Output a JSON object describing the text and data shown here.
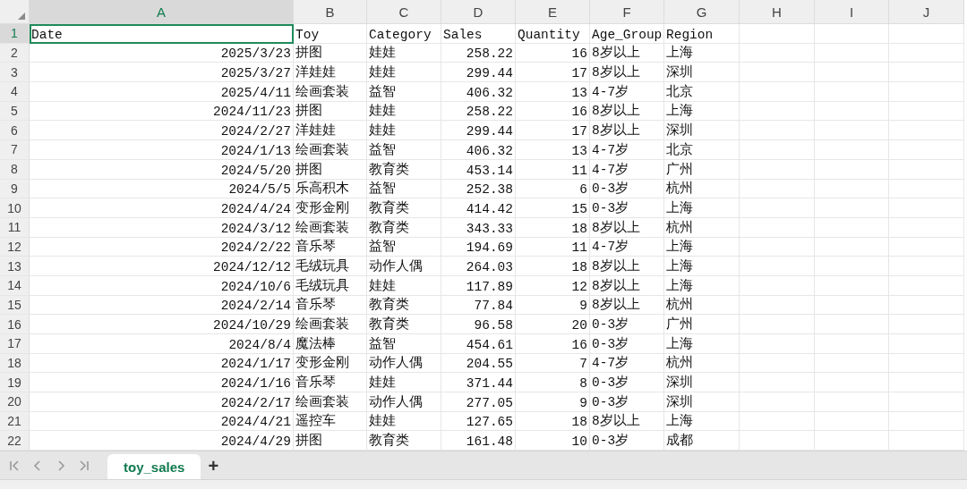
{
  "columns": [
    {
      "label": "A",
      "kind": "date",
      "selected": true
    },
    {
      "label": "B",
      "kind": "text",
      "selected": false
    },
    {
      "label": "C",
      "kind": "text",
      "selected": false
    },
    {
      "label": "D",
      "kind": "number",
      "selected": false
    },
    {
      "label": "E",
      "kind": "number",
      "selected": false
    },
    {
      "label": "F",
      "kind": "text",
      "selected": false
    },
    {
      "label": "G",
      "kind": "text",
      "selected": false
    },
    {
      "label": "H",
      "selected": false
    },
    {
      "label": "I",
      "selected": false
    },
    {
      "label": "J",
      "selected": false
    }
  ],
  "rows": [
    {
      "number": "1",
      "kind": "header",
      "selected": true,
      "cells": [
        "Date",
        "Toy",
        "Category",
        "Sales",
        "Quantity",
        "Age_Group",
        "Region"
      ]
    },
    {
      "number": "2",
      "kind": "data",
      "selected": false,
      "cells": [
        "2025/3/23",
        "拼图",
        "娃娃",
        "258.22",
        "16",
        "8岁以上",
        "上海"
      ]
    },
    {
      "number": "3",
      "kind": "data",
      "selected": false,
      "cells": [
        "2025/3/27",
        "洋娃娃",
        "娃娃",
        "299.44",
        "17",
        "8岁以上",
        "深圳"
      ]
    },
    {
      "number": "4",
      "kind": "data",
      "selected": false,
      "cells": [
        "2025/4/11",
        "绘画套装",
        "益智",
        "406.32",
        "13",
        "4-7岁",
        "北京"
      ]
    },
    {
      "number": "5",
      "kind": "data",
      "selected": false,
      "cells": [
        "2024/11/23",
        "拼图",
        "娃娃",
        "258.22",
        "16",
        "8岁以上",
        "上海"
      ]
    },
    {
      "number": "6",
      "kind": "data",
      "selected": false,
      "cells": [
        "2024/2/27",
        "洋娃娃",
        "娃娃",
        "299.44",
        "17",
        "8岁以上",
        "深圳"
      ]
    },
    {
      "number": "7",
      "kind": "data",
      "selected": false,
      "cells": [
        "2024/1/13",
        "绘画套装",
        "益智",
        "406.32",
        "13",
        "4-7岁",
        "北京"
      ]
    },
    {
      "number": "8",
      "kind": "data",
      "selected": false,
      "cells": [
        "2024/5/20",
        "拼图",
        "教育类",
        "453.14",
        "11",
        "4-7岁",
        "广州"
      ]
    },
    {
      "number": "9",
      "kind": "data",
      "selected": false,
      "cells": [
        "2024/5/5",
        "乐高积木",
        "益智",
        "252.38",
        "6",
        "0-3岁",
        "杭州"
      ]
    },
    {
      "number": "10",
      "kind": "data",
      "selected": false,
      "cells": [
        "2024/4/24",
        "变形金刚",
        "教育类",
        "414.42",
        "15",
        "0-3岁",
        "上海"
      ]
    },
    {
      "number": "11",
      "kind": "data",
      "selected": false,
      "cells": [
        "2024/3/12",
        "绘画套装",
        "教育类",
        "343.33",
        "18",
        "8岁以上",
        "杭州"
      ]
    },
    {
      "number": "12",
      "kind": "data",
      "selected": false,
      "cells": [
        "2024/2/22",
        "音乐琴",
        "益智",
        "194.69",
        "11",
        "4-7岁",
        "上海"
      ]
    },
    {
      "number": "13",
      "kind": "data",
      "selected": false,
      "cells": [
        "2024/12/12",
        "毛绒玩具",
        "动作人偶",
        "264.03",
        "18",
        "8岁以上",
        "上海"
      ]
    },
    {
      "number": "14",
      "kind": "data",
      "selected": false,
      "cells": [
        "2024/10/6",
        "毛绒玩具",
        "娃娃",
        "117.89",
        "12",
        "8岁以上",
        "上海"
      ]
    },
    {
      "number": "15",
      "kind": "data",
      "selected": false,
      "cells": [
        "2024/2/14",
        "音乐琴",
        "教育类",
        "77.84",
        "9",
        "8岁以上",
        "杭州"
      ]
    },
    {
      "number": "16",
      "kind": "data",
      "selected": false,
      "cells": [
        "2024/10/29",
        "绘画套装",
        "教育类",
        "96.58",
        "20",
        "0-3岁",
        "广州"
      ]
    },
    {
      "number": "17",
      "kind": "data",
      "selected": false,
      "cells": [
        "2024/8/4",
        "魔法棒",
        "益智",
        "454.61",
        "16",
        "0-3岁",
        "上海"
      ]
    },
    {
      "number": "18",
      "kind": "data",
      "selected": false,
      "cells": [
        "2024/1/17",
        "变形金刚",
        "动作人偶",
        "204.55",
        "7",
        "4-7岁",
        "杭州"
      ]
    },
    {
      "number": "19",
      "kind": "data",
      "selected": false,
      "cells": [
        "2024/1/16",
        "音乐琴",
        "娃娃",
        "371.44",
        "8",
        "0-3岁",
        "深圳"
      ]
    },
    {
      "number": "20",
      "kind": "data",
      "selected": false,
      "cells": [
        "2024/2/17",
        "绘画套装",
        "动作人偶",
        "277.05",
        "9",
        "0-3岁",
        "深圳"
      ]
    },
    {
      "number": "21",
      "kind": "data",
      "selected": false,
      "cells": [
        "2024/4/21",
        "遥控车",
        "娃娃",
        "127.65",
        "18",
        "8岁以上",
        "上海"
      ]
    },
    {
      "number": "22",
      "kind": "data",
      "selected": false,
      "cells": [
        "2024/4/29",
        "拼图",
        "教育类",
        "161.48",
        "10",
        "0-3岁",
        "成都"
      ]
    }
  ],
  "sheet_tabs": [
    {
      "label": "toy_sales",
      "selected": true
    }
  ],
  "add_sheet": "+"
}
